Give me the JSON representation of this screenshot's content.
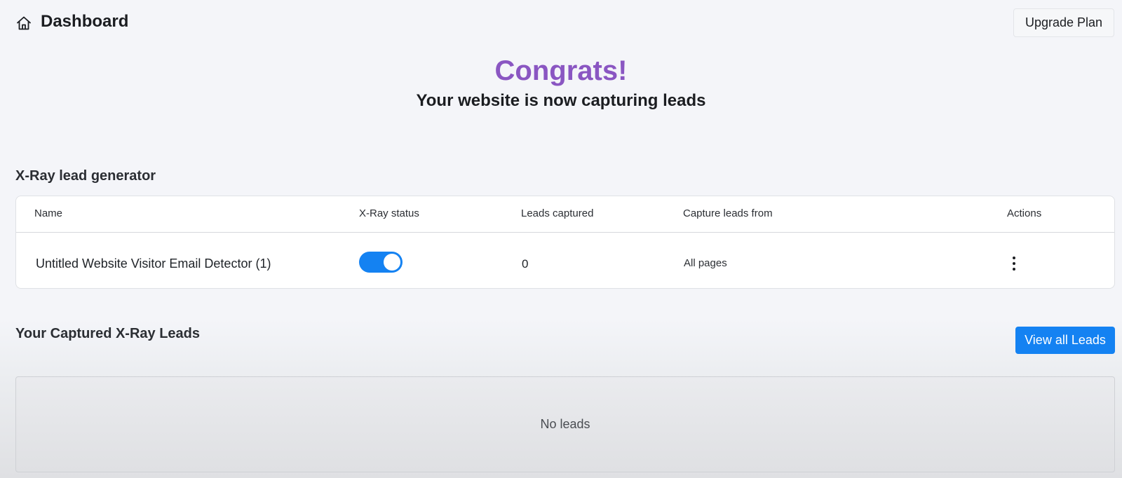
{
  "header": {
    "title": "Dashboard",
    "home_icon": "home-icon",
    "upgrade_label": "Upgrade Plan"
  },
  "hero": {
    "title": "Congrats!",
    "subtitle": "Your website is now capturing leads",
    "title_color": "#8a56c2"
  },
  "generator": {
    "section_title": "X-Ray lead generator",
    "columns": [
      "Name",
      "X-Ray status",
      "Leads captured",
      "Capture leads from",
      "Actions"
    ],
    "rows": [
      {
        "name": "Untitled Website Visitor Email Detector (1)",
        "status_on": true,
        "leads": "0",
        "capture_from": "All pages",
        "actions_icon": "more-vertical-icon"
      }
    ]
  },
  "captured": {
    "section_title": "Your Captured X-Ray Leads",
    "view_all_label": "View all Leads",
    "empty_text": "No leads"
  },
  "colors": {
    "accent": "#1482f2",
    "background": "#f4f5f9"
  }
}
